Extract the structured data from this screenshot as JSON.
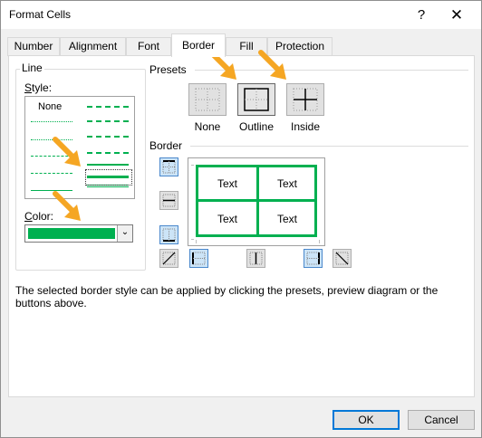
{
  "window": {
    "title": "Format Cells",
    "help": "?",
    "close": "✕"
  },
  "tabs": [
    {
      "label": "Number",
      "active": false
    },
    {
      "label": "Alignment",
      "active": false
    },
    {
      "label": "Font",
      "active": false
    },
    {
      "label": "Border",
      "active": true
    },
    {
      "label": "Fill",
      "active": false
    },
    {
      "label": "Protection",
      "active": false
    }
  ],
  "line_group": {
    "caption": "Line",
    "style_label": "Style:",
    "none_label": "None",
    "color_label": "Color:",
    "color_value": "#00b050"
  },
  "presets": {
    "caption": "Presets",
    "none_label": "None",
    "outline_label": "Outline",
    "inside_label": "Inside"
  },
  "border": {
    "caption": "Border",
    "cell_texts": [
      "Text",
      "Text",
      "Text",
      "Text"
    ]
  },
  "info_text": "The selected border style can be applied by clicking the presets, preview diagram or the buttons above.",
  "footer": {
    "ok": "OK",
    "cancel": "Cancel"
  },
  "colors": {
    "accent": "#0078d7",
    "border_color": "#00b050",
    "arrow": "#f5a623"
  }
}
